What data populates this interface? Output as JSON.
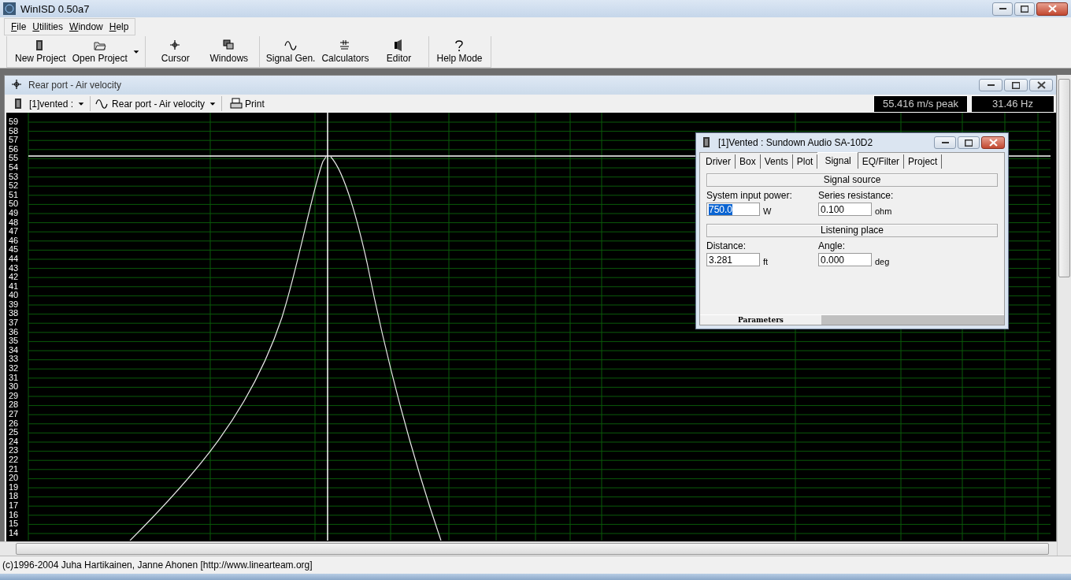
{
  "window": {
    "title": "WinISD 0.50a7"
  },
  "menu": [
    {
      "label": "File"
    },
    {
      "label": "Utilities"
    },
    {
      "label": "Window"
    },
    {
      "label": "Help"
    }
  ],
  "toolbar": [
    {
      "buttons": [
        {
          "label": "New Project",
          "dropdown": false
        },
        {
          "label": "Open Project",
          "dropdown": true
        }
      ]
    },
    {
      "buttons": [
        {
          "label": "Cursor",
          "dropdown": false
        },
        {
          "label": "Windows",
          "dropdown": false
        }
      ]
    },
    {
      "buttons": [
        {
          "label": "Signal Gen.",
          "dropdown": false
        },
        {
          "label": "Calculators",
          "dropdown": false
        },
        {
          "label": "Editor",
          "dropdown": false
        }
      ]
    },
    {
      "buttons": [
        {
          "label": "Help Mode",
          "dropdown": false
        }
      ]
    }
  ],
  "plot_window": {
    "title": "Rear port - Air velocity",
    "project_select": "[1]vented :",
    "graph_select": "Rear port - Air velocity",
    "print": "Print",
    "readouts": [
      "55.416 m/s peak",
      "31.46 Hz"
    ],
    "y_axis_labels": [
      "59",
      "58",
      "57",
      "56",
      "55",
      "54",
      "53",
      "52",
      "51",
      "50",
      "49",
      "48",
      "47",
      "46",
      "45",
      "44",
      "43",
      "42",
      "41",
      "40",
      "39",
      "38",
      "37",
      "36",
      "35",
      "34",
      "33",
      "32",
      "31",
      "30",
      "29",
      "28",
      "27",
      "26",
      "25",
      "24",
      "23",
      "22",
      "21",
      "20",
      "19",
      "18",
      "17",
      "16",
      "15",
      "14"
    ]
  },
  "dialog": {
    "title": "[1]Vented : Sundown Audio SA-10D2",
    "tabs": [
      {
        "label": "Driver",
        "selected": false
      },
      {
        "label": "Box",
        "selected": false
      },
      {
        "label": "Vents",
        "selected": false
      },
      {
        "label": "Plot",
        "selected": false
      },
      {
        "label": "Signal",
        "selected": true
      },
      {
        "label": "EQ/Filter",
        "selected": false
      },
      {
        "label": "Project",
        "selected": false
      }
    ],
    "sections": [
      {
        "heading": "Signal source",
        "fields": [
          {
            "label": "System input power:",
            "value": "750.0",
            "unit": "W",
            "highlighted": true
          },
          {
            "label": "Series resistance:",
            "value": "0.100",
            "unit": "ohm",
            "highlighted": false
          }
        ]
      },
      {
        "heading": "Listening place",
        "fields": [
          {
            "label": "Distance:",
            "value": "3.281",
            "unit": "ft",
            "highlighted": false
          },
          {
            "label": "Angle:",
            "value": "0.000",
            "unit": "deg",
            "highlighted": false
          }
        ]
      }
    ],
    "bottom_tabs": [
      {
        "label": "Parameters",
        "selected": true
      }
    ]
  },
  "status_bar": "(c)1996-2004 Juha Hartikainen, Janne Ahonen [http://www.linearteam.org]"
}
